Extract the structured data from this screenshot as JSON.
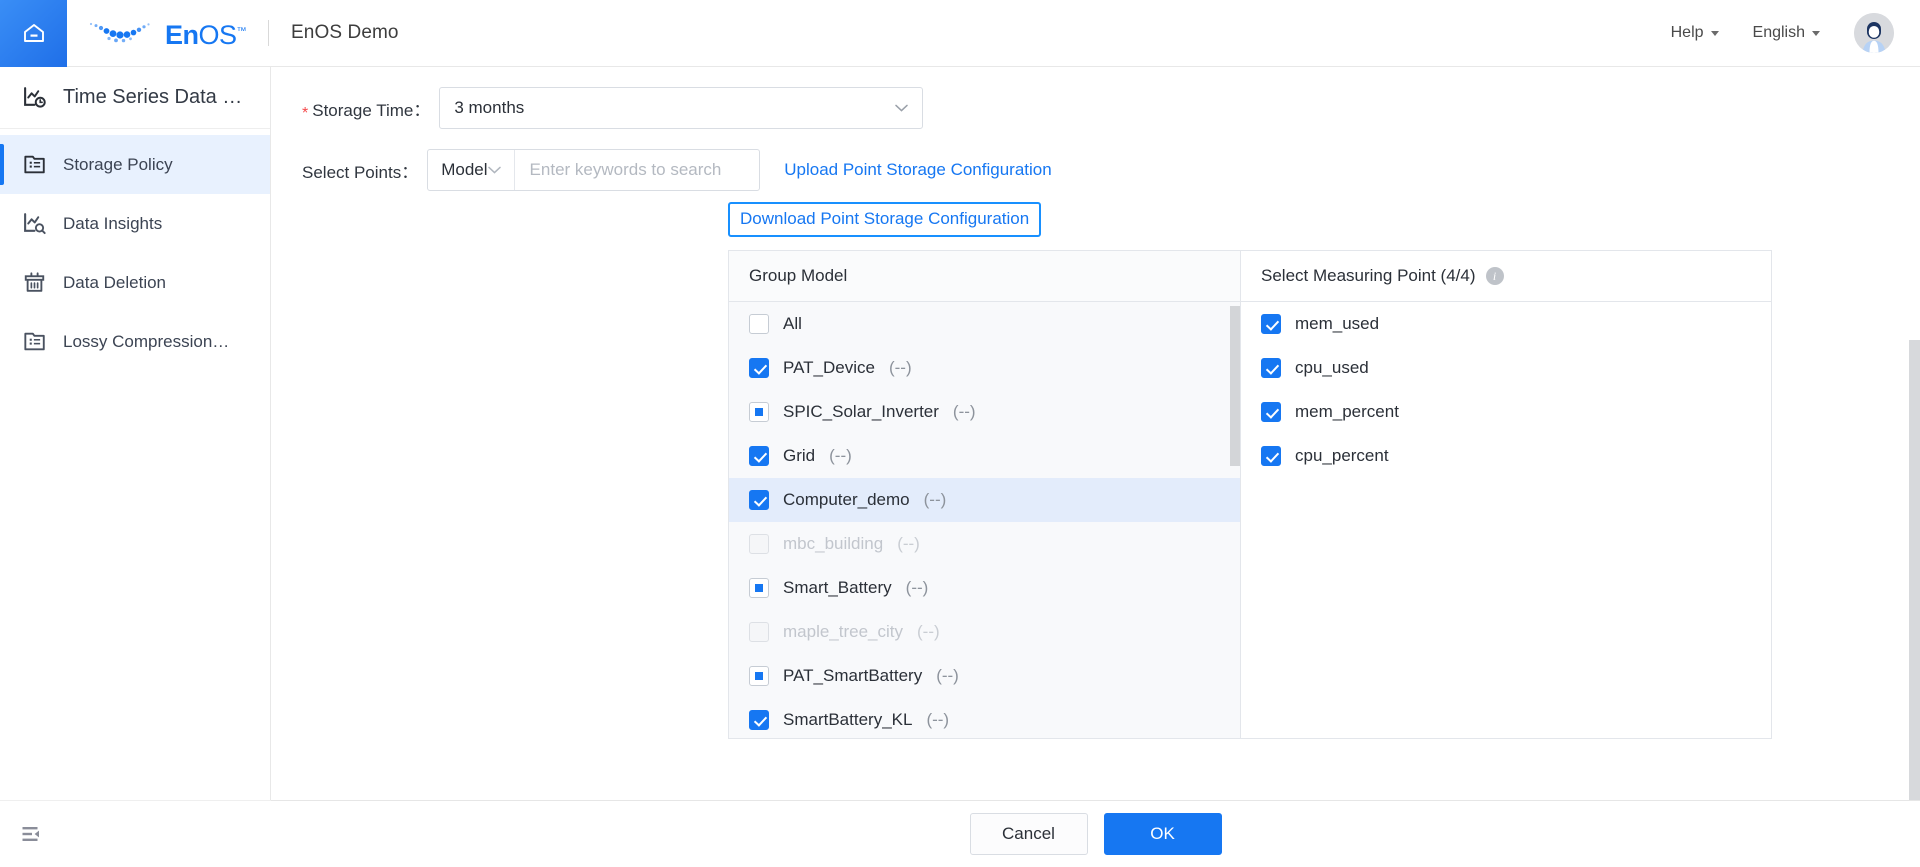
{
  "colors": {
    "brand_blue": "#1677f2",
    "focus_blue": "#1890ff",
    "active_bg": "#e8f1fe",
    "row_highlight": "#e3ecfb",
    "required_red": "#f5494b",
    "muted_text": "#8d939c"
  },
  "topbar": {
    "home_icon": "home-icon",
    "logo_en": "En",
    "logo_os": "OS",
    "logo_tm": "™",
    "app_title": "EnOS Demo",
    "help_label": "Help",
    "language_label": "English",
    "avatar_icon": "user-avatar"
  },
  "sidebar": {
    "header": {
      "icon": "time-series-chart-icon",
      "label": "Time Series Data …"
    },
    "items": [
      {
        "label": "Storage Policy",
        "icon": "document-list-icon",
        "active": true
      },
      {
        "label": "Data Insights",
        "icon": "insights-chart-icon",
        "active": false
      },
      {
        "label": "Data Deletion",
        "icon": "trash-bin-icon",
        "active": false
      },
      {
        "label": "Lossy Compression…",
        "icon": "document-list-icon",
        "active": false
      }
    ],
    "collapse_icon": "sidebar-collapse-icon"
  },
  "form": {
    "storage_time": {
      "required_mark": "*",
      "label": "Storage Time：",
      "value": "3 months",
      "chevron": "chevron-down-icon"
    },
    "select_points": {
      "label": "Select Points：",
      "type_value": "Model",
      "type_chevron": "chevron-down-icon",
      "search_value": "",
      "search_placeholder": "Enter keywords to search",
      "search_icon": "search-icon"
    },
    "upload_link": "Upload Point Storage Configuration",
    "download_link": "Download Point Storage Configuration"
  },
  "transfer": {
    "left": {
      "title": "Group Model",
      "options": [
        {
          "label": "All",
          "suffix": "",
          "state": "unchecked",
          "disabled": false,
          "highlight": false
        },
        {
          "label": "PAT_Device",
          "suffix": "(--)",
          "state": "checked",
          "disabled": false,
          "highlight": false
        },
        {
          "label": "SPIC_Solar_Inverter",
          "suffix": "(--)",
          "state": "indeterminate",
          "disabled": false,
          "highlight": false
        },
        {
          "label": "Grid",
          "suffix": "(--)",
          "state": "checked",
          "disabled": false,
          "highlight": false
        },
        {
          "label": "Computer_demo",
          "suffix": "(--)",
          "state": "checked",
          "disabled": false,
          "highlight": true
        },
        {
          "label": "mbc_building",
          "suffix": "(--)",
          "state": "unchecked",
          "disabled": true,
          "highlight": false
        },
        {
          "label": "Smart_Battery",
          "suffix": "(--)",
          "state": "indeterminate",
          "disabled": false,
          "highlight": false
        },
        {
          "label": "maple_tree_city",
          "suffix": "(--)",
          "state": "unchecked",
          "disabled": true,
          "highlight": false
        },
        {
          "label": "PAT_SmartBattery",
          "suffix": "(--)",
          "state": "indeterminate",
          "disabled": false,
          "highlight": false
        },
        {
          "label": "SmartBattery_KL",
          "suffix": "(--)",
          "state": "checked",
          "disabled": false,
          "highlight": false
        }
      ]
    },
    "right": {
      "title": "Select Measuring Point (4/4)",
      "info_icon": "info-icon",
      "options": [
        {
          "label": "mem_used",
          "state": "checked"
        },
        {
          "label": "cpu_used",
          "state": "checked"
        },
        {
          "label": "mem_percent",
          "state": "checked"
        },
        {
          "label": "cpu_percent",
          "state": "checked"
        }
      ]
    }
  },
  "footer": {
    "cancel_label": "Cancel",
    "ok_label": "OK"
  }
}
